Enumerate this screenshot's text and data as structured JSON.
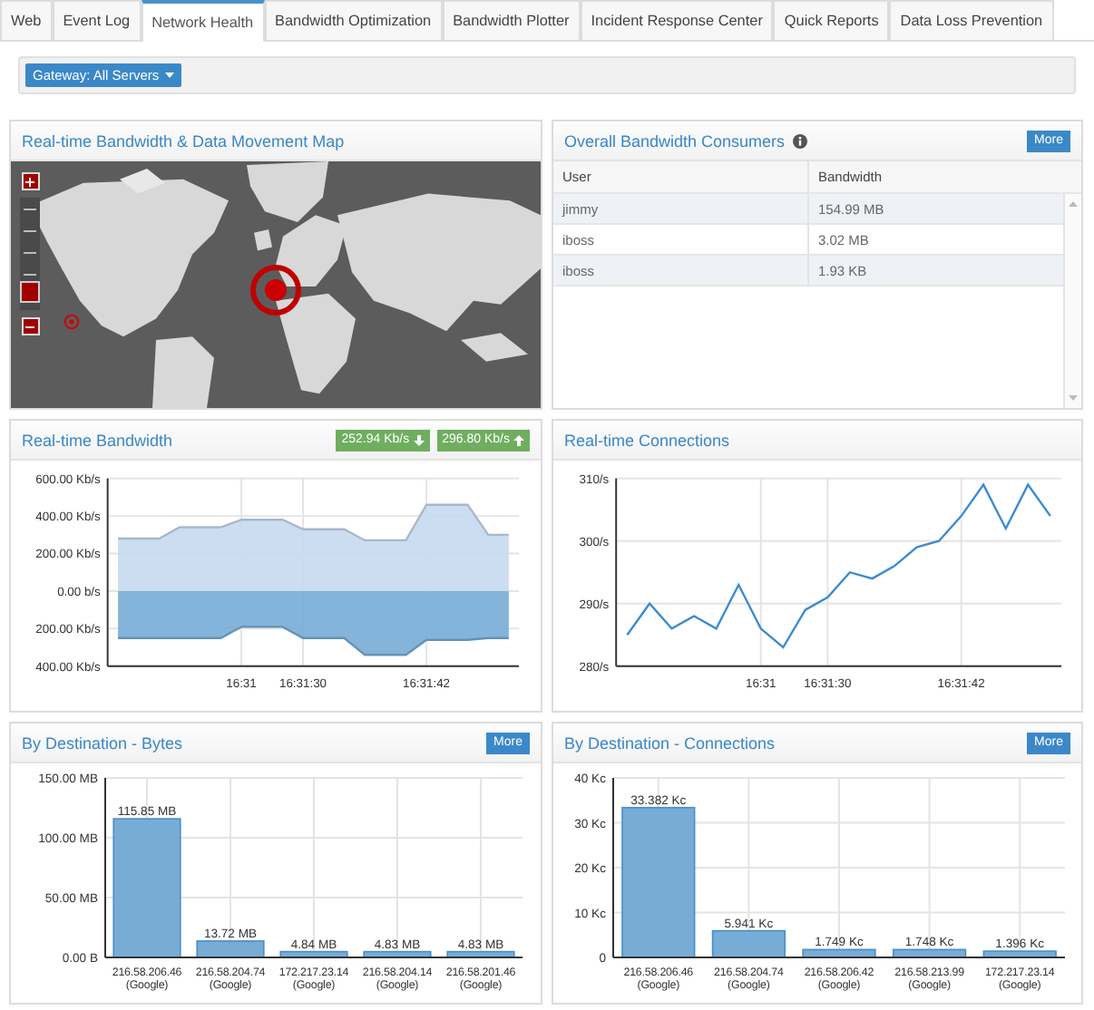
{
  "tabs": [
    {
      "label": "Web",
      "selected": false
    },
    {
      "label": "Event Log",
      "selected": false
    },
    {
      "label": "Network Health",
      "selected": true
    },
    {
      "label": "Bandwidth Optimization",
      "selected": false
    },
    {
      "label": "Bandwidth Plotter",
      "selected": false
    },
    {
      "label": "Incident Response Center",
      "selected": false
    },
    {
      "label": "Quick Reports",
      "selected": false
    },
    {
      "label": "Data Loss Prevention",
      "selected": false
    }
  ],
  "gateway_button": {
    "label": "Gateway: All Servers"
  },
  "map_panel": {
    "title": "Real-time Bandwidth & Data Movement Map",
    "zoom_slider": {
      "level": 0.05
    }
  },
  "consumers_panel": {
    "title": "Overall Bandwidth Consumers",
    "more_button": "More",
    "columns": [
      "User",
      "Bandwidth"
    ],
    "rows": [
      [
        "jimmy",
        "154.99 MB"
      ],
      [
        "iboss",
        "3.02 MB"
      ],
      [
        "iboss",
        "1.93 KB"
      ]
    ]
  },
  "bandwidth_panel": {
    "title": "Real-time Bandwidth",
    "readings": [
      {
        "value": "252.94 Kb/s",
        "kind": "down"
      },
      {
        "value": "296.80 Kb/s",
        "kind": "up"
      }
    ],
    "chart_data": {
      "type": "area",
      "categories": [
        null,
        null,
        null,
        null,
        null,
        null,
        "16:31",
        null,
        null,
        "16:31:30",
        null,
        null,
        null,
        null,
        null,
        "16:31:42",
        null,
        null,
        null,
        null
      ],
      "ylim": [
        -400,
        600
      ],
      "grid": true,
      "yticks": [
        {
          "value": 600,
          "label": "600.00 Kb/s"
        },
        {
          "value": 400,
          "label": "400.00 Kb/s"
        },
        {
          "value": 200,
          "label": "200.00 Kb/s"
        },
        {
          "value": 0,
          "label": "0.00 b/s"
        },
        {
          "value": -200,
          "label": "200.00 Kb/s"
        },
        {
          "value": -400,
          "label": "400.00 Kb/s"
        }
      ],
      "series": [
        {
          "color": "#c6d9ef",
          "values": [
            280,
            280,
            280,
            340,
            340,
            340,
            380,
            380,
            380,
            330,
            330,
            330,
            270,
            270,
            270,
            460,
            460,
            460,
            300,
            300
          ]
        },
        {
          "color": "#77acd6",
          "values": [
            -250,
            -250,
            -250,
            -250,
            -250,
            -250,
            -190,
            -190,
            -190,
            -250,
            -250,
            -250,
            -340,
            -340,
            -340,
            -260,
            -260,
            -260,
            -250,
            -250
          ]
        }
      ]
    }
  },
  "connections_panel": {
    "title": "Real-time Connections",
    "chart_data": {
      "type": "line",
      "categories": [
        null,
        null,
        null,
        null,
        null,
        null,
        "16:31",
        null,
        null,
        "16:31:30",
        null,
        null,
        null,
        null,
        null,
        "16:31:42",
        null,
        null,
        null,
        null
      ],
      "ylim": [
        280,
        310
      ],
      "grid": true,
      "yticks": [
        {
          "value": 280,
          "label": "280/s"
        },
        {
          "value": 290,
          "label": "290/s"
        },
        {
          "value": 300,
          "label": "300/s"
        },
        {
          "value": 310,
          "label": "310/s"
        }
      ],
      "series": [
        {
          "color": "#3a8bd0",
          "values": [
            285,
            290,
            286,
            288,
            286,
            293,
            286,
            283,
            289,
            291,
            295,
            294,
            296,
            299,
            300,
            304,
            309,
            302,
            309,
            304
          ]
        }
      ]
    }
  },
  "bytes_panel": {
    "title": "By Destination - Bytes",
    "more_button": "More",
    "chart_data": {
      "type": "bar",
      "categories": [
        "216.58.206.46 (Google)",
        "216.58.204.74 (Google)",
        "172.217.23.14 (Google)",
        "216.58.204.14 (Google)",
        "216.58.201.46 (Google)"
      ],
      "values": [
        115.85,
        13.72,
        4.84,
        4.83,
        4.83
      ],
      "ylim": [
        0,
        150
      ],
      "grid": true,
      "yticks": [
        {
          "value": 0,
          "label": "0.00 B"
        },
        {
          "value": 50,
          "label": "50.00 MB"
        },
        {
          "value": 100,
          "label": "100.00 MB"
        },
        {
          "value": 150,
          "label": "150.00 MB"
        }
      ],
      "value_labels": [
        "115.85 MB",
        "13.72 MB",
        "4.84 MB",
        "4.83 MB",
        "4.83 MB"
      ]
    }
  },
  "dest_connections_panel": {
    "title": "By Destination - Connections",
    "more_button": "More",
    "chart_data": {
      "type": "bar",
      "categories": [
        "216.58.206.46 (Google)",
        "216.58.204.74 (Google)",
        "216.58.206.42 (Google)",
        "216.58.213.99 (Google)",
        "172.217.23.14 (Google)"
      ],
      "values": [
        33.382,
        5.941,
        1.749,
        1.748,
        1.396
      ],
      "ylim": [
        0,
        40
      ],
      "grid": true,
      "yticks": [
        {
          "value": 0,
          "label": "0"
        },
        {
          "value": 10,
          "label": "10 Kc"
        },
        {
          "value": 20,
          "label": "20 Kc"
        },
        {
          "value": 30,
          "label": "30 Kc"
        },
        {
          "value": 40,
          "label": "40 Kc"
        }
      ],
      "value_labels": [
        "33.382 Kc",
        "5.941 Kc",
        "1.749 Kc",
        "1.748 Kc",
        "1.396 Kc"
      ]
    }
  }
}
